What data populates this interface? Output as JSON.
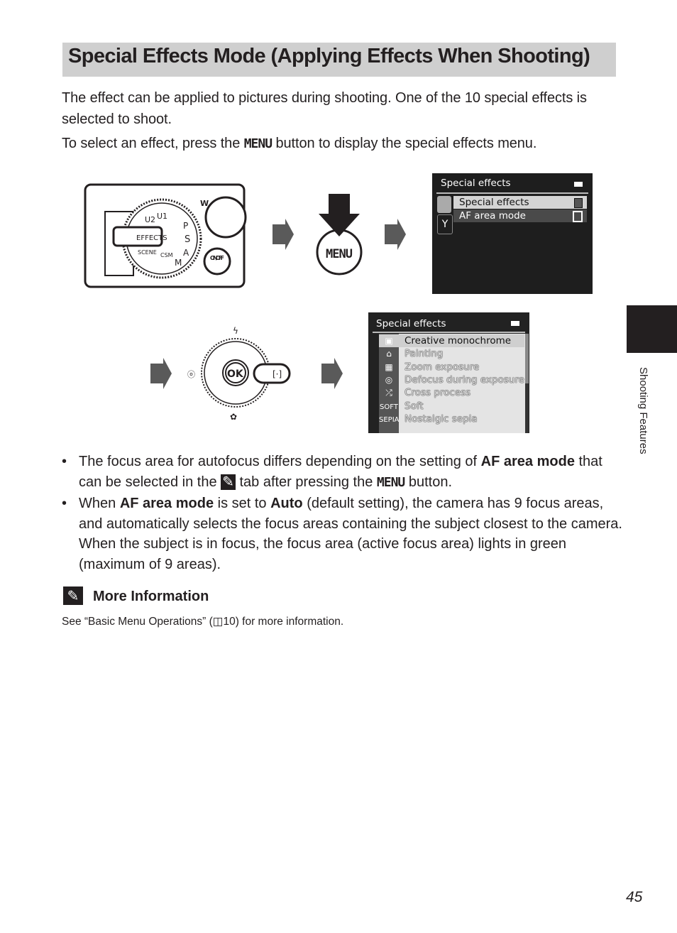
{
  "title": "Special Effects Mode (Applying Effects When Shooting)",
  "intro": {
    "line1": "The effect can be applied to pictures during shooting. One of the 10 special effects is selected to shoot.",
    "line2_before": "To select an effect, press the ",
    "menu_glyph": "MENU",
    "line2_after": " button to display the special effects menu."
  },
  "camera": {
    "dial_labels": [
      "EFFECTS",
      "U1",
      "U2",
      "S",
      "A",
      "M",
      "P",
      "SCENE",
      "CSM"
    ],
    "zoom_label": "W",
    "power_label": "ON/OFF",
    "menu_button": "MENU",
    "ok_button": "OK"
  },
  "screen1": {
    "title": "Special effects",
    "rows": [
      {
        "label": "Special effects",
        "selected": true
      },
      {
        "label": "AF area mode",
        "selected": false
      }
    ]
  },
  "screen2": {
    "title": "Special effects",
    "items": [
      {
        "icon": "▣",
        "label": "Creative monochrome",
        "selected": true
      },
      {
        "icon": "⌂",
        "label": "Painting"
      },
      {
        "icon": "▦",
        "label": "Zoom exposure"
      },
      {
        "icon": "◎",
        "label": "Defocus during exposure"
      },
      {
        "icon": "⤮",
        "label": "Cross process"
      },
      {
        "icon": "SOFT",
        "label": "Soft"
      },
      {
        "icon": "SEPIA",
        "label": "Nostalgic sepia"
      }
    ]
  },
  "bullets": [
    {
      "a": "The focus area for autofocus differs depending on the setting of ",
      "b": "AF area mode",
      "c": " that can be selected in the ",
      "tab_glyph": "✎",
      "d": " tab after pressing the ",
      "menu": "MENU",
      "e": " button."
    },
    {
      "a": "When ",
      "b": "AF area mode",
      "c": " is set to ",
      "d": "Auto",
      "e": " (default setting), the camera has 9 focus areas, and automatically selects the focus areas containing the subject closest to the camera. When the subject is in focus, the focus area (active focus area) lights in green (maximum of 9 areas)."
    }
  ],
  "note": {
    "title": "More Information",
    "text_before": "See “Basic Menu Operations” (",
    "book_glyph": "◫",
    "text_after": "10) for more information."
  },
  "side_label": "Shooting Features",
  "page_number": "45"
}
